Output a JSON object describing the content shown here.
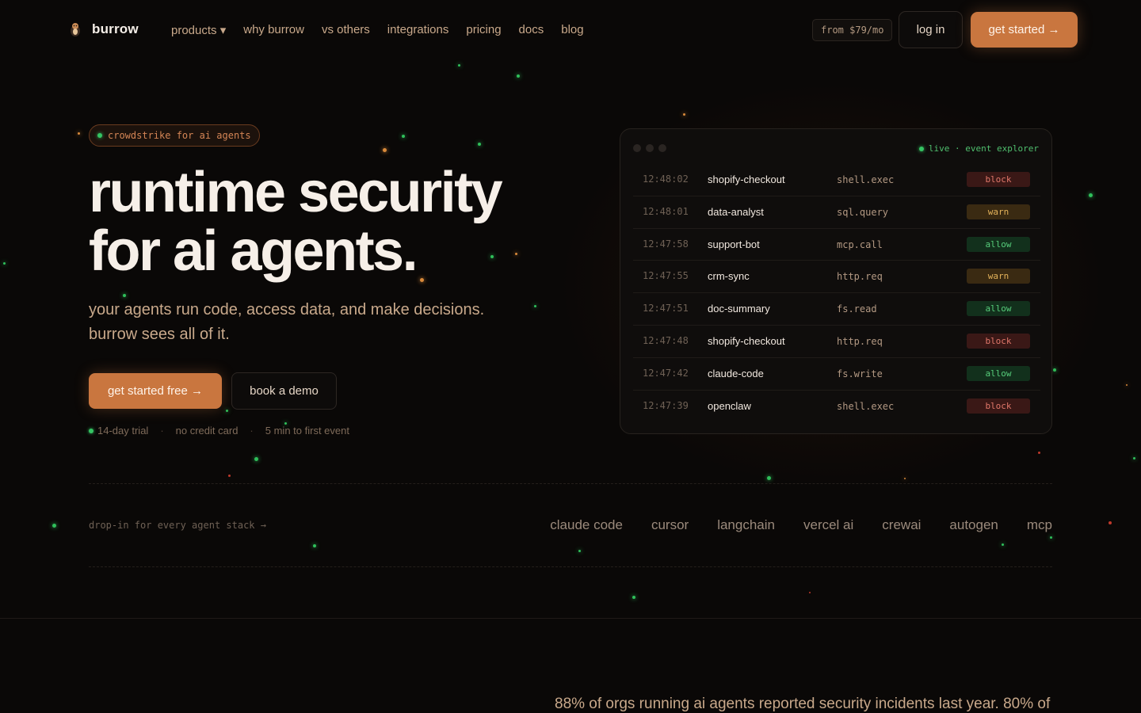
{
  "nav": {
    "brand": "burrow",
    "links": [
      "products ▾",
      "why burrow",
      "vs others",
      "integrations",
      "pricing",
      "docs",
      "blog"
    ],
    "price_pill": "from $79/mo",
    "login": "log in",
    "get_started": "get started →"
  },
  "hero": {
    "badge": "crowdstrike for ai agents",
    "title_line1": "runtime security",
    "title_line2": "for ai agents.",
    "subtitle_line1": "your agents run code, access data, and make decisions.",
    "subtitle_line2": "burrow sees all of it.",
    "primary_cta": "get started free →",
    "secondary_cta": "book a demo",
    "perks": [
      "14-day trial",
      "no credit card",
      "5 min to first event"
    ],
    "perk_separator": "·"
  },
  "explorer": {
    "live_label": "live · event explorer",
    "events": [
      {
        "time": "12:48:02",
        "agent": "shopify-checkout",
        "event": "shell.exec",
        "status": "block"
      },
      {
        "time": "12:48:01",
        "agent": "data-analyst",
        "event": "sql.query",
        "status": "warn"
      },
      {
        "time": "12:47:58",
        "agent": "support-bot",
        "event": "mcp.call",
        "status": "allow"
      },
      {
        "time": "12:47:55",
        "agent": "crm-sync",
        "event": "http.req",
        "status": "warn"
      },
      {
        "time": "12:47:51",
        "agent": "doc-summary",
        "event": "fs.read",
        "status": "allow"
      },
      {
        "time": "12:47:48",
        "agent": "shopify-checkout",
        "event": "http.req",
        "status": "block"
      },
      {
        "time": "12:47:42",
        "agent": "claude-code",
        "event": "fs.write",
        "status": "allow"
      },
      {
        "time": "12:47:39",
        "agent": "openclaw",
        "event": "shell.exec",
        "status": "block"
      }
    ]
  },
  "stack": {
    "label": "drop-in for every agent stack →",
    "items": [
      "claude code",
      "cursor",
      "langchain",
      "vercel ai",
      "crewai",
      "autogen",
      "mcp"
    ]
  },
  "stat_text": "88% of orgs running ai agents reported security incidents last year. 80% of",
  "colors": {
    "background": "#0a0807",
    "accent": "#c9763f",
    "live_green": "#35c463",
    "block": "#e0776a",
    "warn": "#e3b25a",
    "allow": "#56cc7a"
  }
}
